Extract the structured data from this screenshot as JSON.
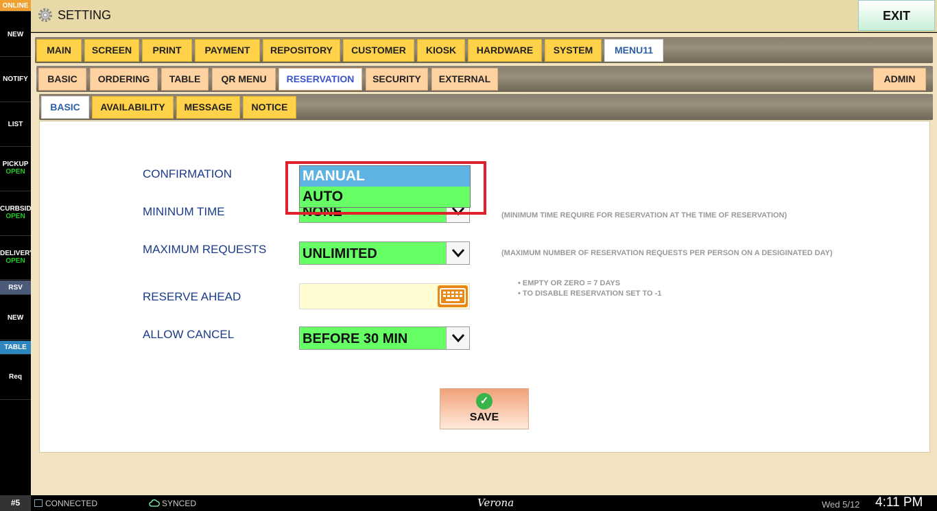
{
  "sidebar": {
    "online": "ONLINE",
    "items": [
      {
        "label": "NEW"
      },
      {
        "label": "NOTIFY"
      },
      {
        "label": "LIST"
      },
      {
        "label": "PICKUP",
        "status": "OPEN"
      },
      {
        "label": "CURBSID",
        "status": "OPEN"
      },
      {
        "label": "DELIVERY",
        "status": "OPEN"
      },
      {
        "label": "RSV"
      },
      {
        "label": "NEW"
      },
      {
        "label": "TABLE"
      },
      {
        "label": "Req"
      }
    ]
  },
  "header": {
    "title": "SETTING",
    "exit_label": "EXIT",
    "icon": "gear-icon"
  },
  "tabs_main": [
    "MAIN",
    "SCREEN",
    "PRINT",
    "PAYMENT",
    "REPOSITORY",
    "CUSTOMER",
    "KIOSK",
    "HARDWARE",
    "SYSTEM",
    "MENU11"
  ],
  "tabs_sub": [
    "BASIC",
    "ORDERING",
    "TABLE",
    "QR MENU",
    "RESERVATION",
    "SECURITY",
    "EXTERNAL",
    "ADMIN"
  ],
  "tabs_third": [
    "BASIC",
    "AVAILABILITY",
    "MESSAGE",
    "NOTICE"
  ],
  "form": {
    "confirmation": {
      "label": "CONFIRMATION",
      "options": [
        "MANUAL",
        "AUTO"
      ],
      "highlighted": "MANUAL"
    },
    "min_time": {
      "label": "MININUM TIME",
      "value": "NONE",
      "hint": "(MINIMUM TIME REQUIRE FOR RESERVATION AT THE TIME OF RESERVATION)"
    },
    "max_requests": {
      "label": "MAXIMUM REQUESTS",
      "value": "UNLIMITED",
      "hint": "(MAXIMUM NUMBER OF RESERVATION REQUESTS PER PERSON ON A DESIGINATED DAY)"
    },
    "reserve_ahead": {
      "label": "RESERVE AHEAD",
      "value": "",
      "hints": [
        "EMPTY OR ZERO = 7 DAYS",
        "TO DISABLE RESERVATION SET TO -1"
      ]
    },
    "allow_cancel": {
      "label": "ALLOW CANCEL",
      "value": "BEFORE 30 MIN"
    }
  },
  "save_label": "SAVE",
  "status": {
    "station": "#5",
    "connection": "CONNECTED",
    "sync": "SYNCED",
    "brand": "Verona",
    "date": "Wed 5/12",
    "time": "4:11 PM"
  },
  "colors": {
    "tab_yellow": "#ffd24a",
    "tab_peach": "#ffd2a2",
    "field_green": "#66ff66",
    "highlight_blue": "#5fb3e3",
    "callout_red": "#e0202a"
  }
}
